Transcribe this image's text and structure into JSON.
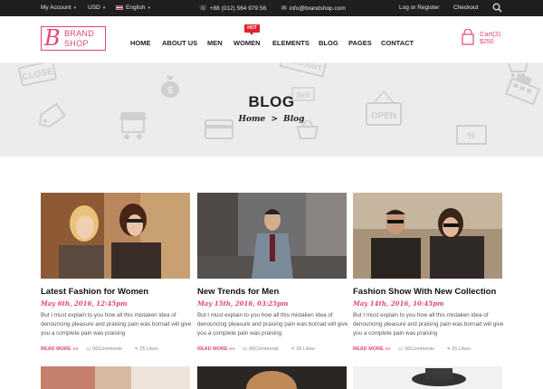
{
  "topbar": {
    "account": "My Account",
    "currency": "USD",
    "language": "English",
    "phone": "+88 (012) 564 979 56",
    "email": "info@brandshop.com",
    "login": "Log or Register",
    "checkout": "Checkout"
  },
  "logo": {
    "letter": "B",
    "line1": "BRAND",
    "line2": "SHOP"
  },
  "nav": {
    "items": [
      "HOME",
      "ABOUT US",
      "MEN",
      "WOMEN",
      "ELEMENTS",
      "BLOG",
      "PAGES",
      "CONTACT"
    ],
    "hot_badge": "HOT"
  },
  "cart": {
    "label": "Cart(3)",
    "total": "$250"
  },
  "banner": {
    "title": "BLOG",
    "breadcrumb_home": "Home",
    "breadcrumb_sep": ">",
    "breadcrumb_current": "Blog",
    "decor_words": [
      "CLOSE",
      "OPEN",
      "Sell",
      "DISCOUNT"
    ]
  },
  "posts": [
    {
      "title": "Latest Fashion for Women",
      "date": "May 6th, 2016, 12:45pm",
      "excerpt": "But I must explain to you how all this mistaken idea of denouncing pleasure and praising pain was bornad will give you a complete pain was praising",
      "read_more": "READ MORE »»",
      "comments": "06Comments",
      "likes": "25 Likes"
    },
    {
      "title": "New Trends for Men",
      "date": "May 15th, 2016, 03:25pm",
      "excerpt": "But I must explain to you how all this mistaken idea of denouncing pleasure and praising pain was bornad will give you a complete pain was praising",
      "read_more": "READ MORE »»",
      "comments": "06Comments",
      "likes": "25 Likes"
    },
    {
      "title": "Fashion Show With New Collection",
      "date": "May 14th, 2016, 10:45pm",
      "excerpt": "But I must explain to you how all this mistaken idea of denouncing pleasure and praising pain was bornad will give you a complete pain was praising",
      "read_more": "READ MORE »»",
      "comments": "06Comments",
      "likes": "25 Likes"
    }
  ],
  "colors": {
    "accent": "#e0457b",
    "topbar": "#1f1f1f",
    "banner": "#ececec",
    "hot": "#e0222a"
  }
}
